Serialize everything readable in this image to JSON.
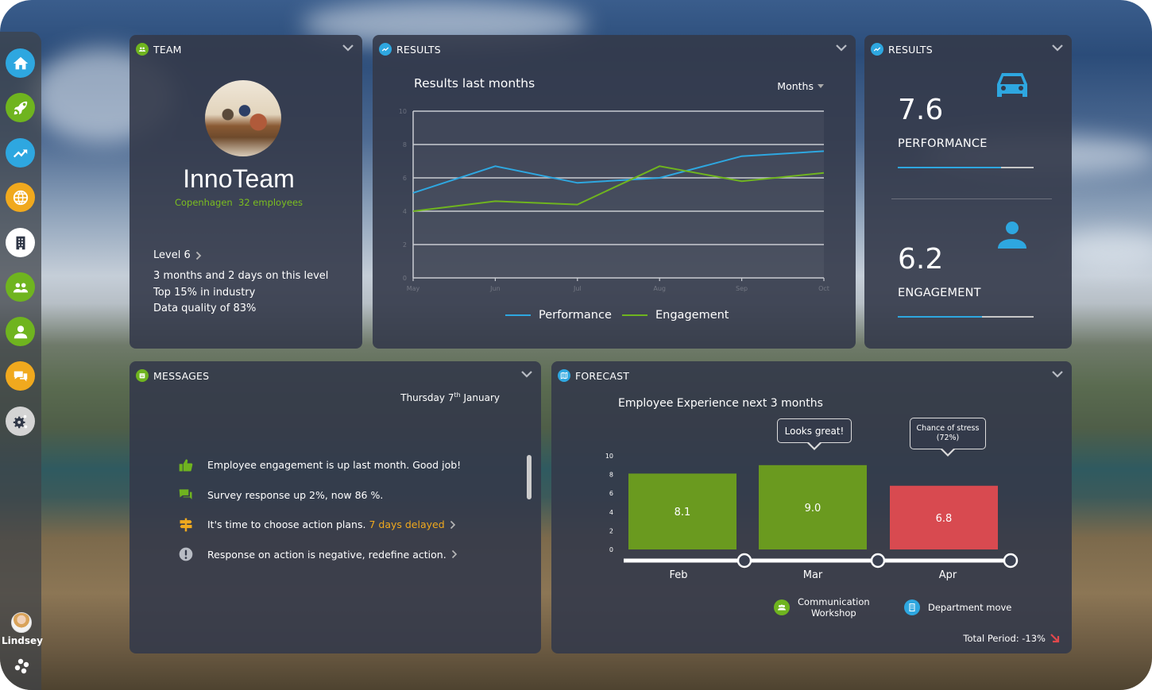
{
  "colors": {
    "blue": "#2ea7e0",
    "green": "#6fb41f",
    "orange": "#f0a91e",
    "red": "#e0484c",
    "bar_green": "#6a9a1f",
    "bar_red": "#d84a50"
  },
  "sidebar": {
    "items": [
      {
        "name": "home",
        "icon": "home-icon",
        "color": "#2ea7e0"
      },
      {
        "name": "launch",
        "icon": "rocket-icon",
        "color": "#6fb41f"
      },
      {
        "name": "results",
        "icon": "trend-icon",
        "color": "#2ea7e0"
      },
      {
        "name": "global",
        "icon": "globe-icon",
        "color": "#f0a91e"
      },
      {
        "name": "organization",
        "icon": "building-icon",
        "color": "#ffffff"
      },
      {
        "name": "teams",
        "icon": "group-icon",
        "color": "#6fb41f"
      },
      {
        "name": "profile",
        "icon": "person-icon",
        "color": "#6fb41f"
      },
      {
        "name": "chat",
        "icon": "chat-icon",
        "color": "#f0a91e"
      },
      {
        "name": "settings",
        "icon": "gear-icon",
        "color": "#d4d4d4"
      }
    ],
    "user": {
      "name": "Lindsey"
    }
  },
  "team": {
    "header": "TEAM",
    "name": "InnoTeam",
    "location": "Copenhagen",
    "employees": "32 employees",
    "level": "Level 6",
    "stats": [
      "3 months and 2 days on this level",
      "Top 15% in industry",
      "Data quality of 83%"
    ]
  },
  "results_chart": {
    "header": "RESULTS",
    "period_select": "Months"
  },
  "chart_data": [
    {
      "type": "line",
      "title": "Results last months",
      "x": [
        "May",
        "Jun",
        "Jul",
        "Aug",
        "Sep",
        "Oct"
      ],
      "series": [
        {
          "name": "Performance",
          "color": "#2ea7e0",
          "values": [
            5.1,
            6.7,
            5.7,
            6.0,
            7.3,
            7.6
          ]
        },
        {
          "name": "Engagement",
          "color": "#6fb41f",
          "values": [
            4.0,
            4.6,
            4.4,
            6.7,
            5.8,
            6.3
          ]
        }
      ],
      "ylim": [
        0,
        10
      ],
      "yticks": [
        0,
        2,
        4,
        6,
        8,
        10
      ],
      "grid": true,
      "legend": "bottom"
    },
    {
      "type": "bar",
      "title": "Employee Experience next 3 months",
      "categories": [
        "Feb",
        "Mar",
        "Apr"
      ],
      "values": [
        8.1,
        9.0,
        6.8
      ],
      "labels": [
        "8.1",
        "9.0",
        "6.8"
      ],
      "bar_colors": [
        "#6a9a1f",
        "#6a9a1f",
        "#d84a50"
      ],
      "ylim": [
        0,
        10
      ],
      "yticks": [
        0,
        2,
        4,
        6,
        8,
        10
      ],
      "annotations": [
        {
          "category": "Mar",
          "text": "Looks great!"
        },
        {
          "category": "Apr",
          "text": "Chance of stress",
          "subtext": "(72%)"
        }
      ]
    }
  ],
  "kpis": {
    "header": "RESULTS",
    "items": [
      {
        "value": "7.6",
        "label": "PERFORMANCE",
        "fill": 0.76,
        "icon": "car-icon"
      },
      {
        "value": "6.2",
        "label": "ENGAGEMENT",
        "fill": 0.62,
        "icon": "person-icon"
      }
    ]
  },
  "messages": {
    "header": "MESSAGES",
    "date_day": "Thursday 7",
    "date_suffix": "th",
    "date_month": "January",
    "items": [
      {
        "icon": "thumbs-up-icon",
        "text": "Employee engagement is up last month. Good job!",
        "extra": "",
        "arrow": false
      },
      {
        "icon": "chat-icon",
        "text": "Survey response up 2%, now 86 %.",
        "extra": "",
        "arrow": false
      },
      {
        "icon": "signpost-icon",
        "text": "It's time to choose action plans.",
        "extra": "7 days delayed",
        "arrow": true
      },
      {
        "icon": "alert-icon",
        "text": "Response on action is negative, redefine action.",
        "extra": "",
        "arrow": true
      }
    ]
  },
  "forecast": {
    "header": "FORECAST",
    "events": [
      {
        "icon": "group-icon",
        "label_line1": "Communication",
        "label_line2": "Workshop"
      },
      {
        "icon": "building-icon",
        "label_line1": "Department move",
        "label_line2": ""
      }
    ],
    "total": "Total Period: -13%"
  }
}
